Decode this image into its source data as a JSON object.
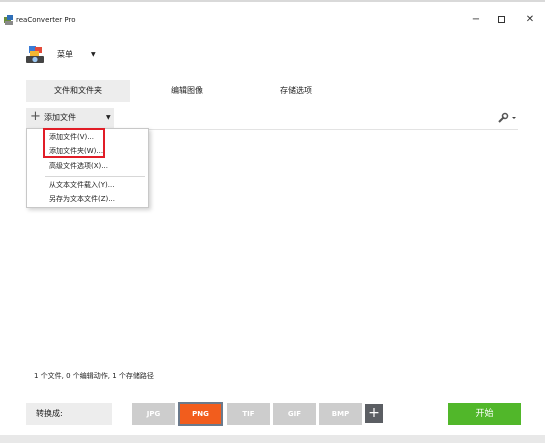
{
  "window": {
    "title": "reaConverter Pro",
    "minimize_glyph": "−",
    "close_glyph": "✕"
  },
  "menu": {
    "label": "菜单",
    "caret": "▼"
  },
  "tabs": [
    {
      "label": "文件和文件夹",
      "active": true
    },
    {
      "label": "编辑图像",
      "active": false
    },
    {
      "label": "存储选项",
      "active": false
    }
  ],
  "toolbar": {
    "add_file_label": "添加文件",
    "add_file_caret": "▼",
    "settings_icon": "wrench-icon"
  },
  "dropdown": {
    "items": [
      "添加文件(V)...",
      "添加文件夹(W)...",
      "高级文件选项(X)...",
      "从文本文件载入(Y)...",
      "另存为文本文件(Z)..."
    ]
  },
  "status": {
    "text": "1 个文件, 0 个编辑动作, 1 个存储路径"
  },
  "bottom": {
    "convert_to_label": "转换成:",
    "formats": [
      {
        "label": "JPG",
        "selected": false
      },
      {
        "label": "PNG",
        "selected": true
      },
      {
        "label": "TIF",
        "selected": false
      },
      {
        "label": "GIF",
        "selected": false
      },
      {
        "label": "BMP",
        "selected": false
      }
    ],
    "add_format": "+",
    "start_label": "开始"
  },
  "colors": {
    "selected_format": "#f25d1d",
    "start_button": "#51b72a",
    "highlight_box": "#e11d27"
  }
}
